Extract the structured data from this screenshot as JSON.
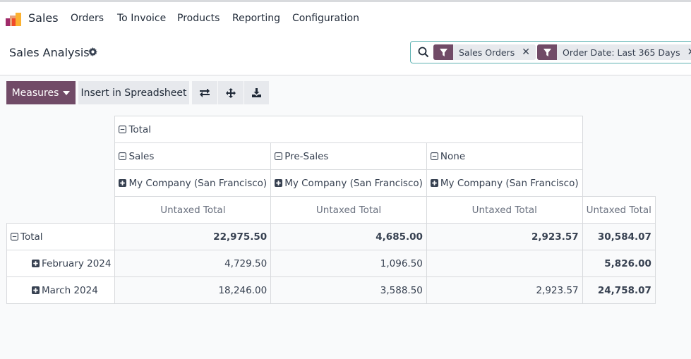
{
  "app": {
    "name": "Sales",
    "menu": [
      "Orders",
      "To Invoice",
      "Products",
      "Reporting",
      "Configuration"
    ]
  },
  "control": {
    "title": "Sales Analysis",
    "search": {
      "facets": [
        {
          "icon": "filter-icon",
          "label": "Sales Orders"
        },
        {
          "icon": "filter-icon",
          "label": "Order Date: Last 365 Days"
        }
      ]
    }
  },
  "toolbar": {
    "measures_label": "Measures",
    "insert_label": "Insert in Spreadsheet",
    "icons": [
      "flip-axis-icon",
      "expand-all-icon",
      "download-icon"
    ]
  },
  "pivot": {
    "col_total": "Total",
    "col_groups": [
      "Sales",
      "Pre-Sales",
      "None"
    ],
    "col_subgroups": [
      "My Company (San Francisco)",
      "My Company (San Francisco)",
      "My Company (San Francisco)"
    ],
    "measure": "Untaxed Total",
    "rows": [
      {
        "label": "Total",
        "values": [
          "22,975.50",
          "4,685.00",
          "2,923.57"
        ],
        "total": "30,584.07"
      },
      {
        "label": "February 2024",
        "values": [
          "4,729.50",
          "1,096.50",
          ""
        ],
        "total": "5,826.00"
      },
      {
        "label": "March 2024",
        "values": [
          "18,246.00",
          "3,588.50",
          "2,923.57"
        ],
        "total": "24,758.07"
      }
    ]
  },
  "colors": {
    "brand": "#714b67",
    "search_border": "#5fb3b3"
  }
}
